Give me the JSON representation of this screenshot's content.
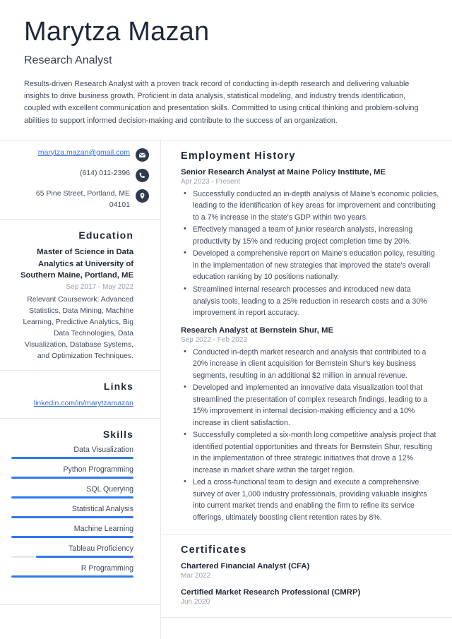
{
  "header": {
    "name": "Marytza Mazan",
    "job_title": "Research Analyst",
    "summary": "Results-driven Research Analyst with a proven track record of conducting in-depth research and delivering valuable insights to drive business growth. Proficient in data analysis, statistical modeling, and industry trends identification, coupled with excellent communication and presentation skills. Committed to using critical thinking and problem-solving abilities to support informed decision-making and contribute to the success of an organization."
  },
  "sidebar": {
    "contact": [
      {
        "icon": "envelope-icon",
        "text": "marytza.mazan@gmail.com",
        "is_link": true
      },
      {
        "icon": "phone-icon",
        "text": "(614) 011-2396",
        "is_link": false
      },
      {
        "icon": "location-pin-icon",
        "text": "65 Pine Street, Portland, ME 04101",
        "is_link": false
      }
    ],
    "education": {
      "title": "Education",
      "degree": "Master of Science in Data Analytics at University of Southern Maine, Portland, ME",
      "date": "Sep 2017 - May 2022",
      "description": "Relevant Coursework: Advanced Statistics, Data Mining, Machine Learning, Predictive Analytics, Big Data Technologies, Data Visualization, Database Systems, and Optimization Techniques."
    },
    "links": {
      "title": "Links",
      "items": [
        {
          "label": "linkedin.com/in/marytzamazan"
        }
      ]
    },
    "skills": {
      "title": "Skills",
      "items": [
        {
          "label": "Data Visualization",
          "level": 100
        },
        {
          "label": "Python Programming",
          "level": 100
        },
        {
          "label": "SQL Querying",
          "level": 100
        },
        {
          "label": "Statistical Analysis",
          "level": 100
        },
        {
          "label": "Machine Learning",
          "level": 100
        },
        {
          "label": "Tableau Proficiency",
          "level": 80
        },
        {
          "label": "R Programming",
          "level": 100
        }
      ]
    }
  },
  "main": {
    "employment": {
      "title": "Employment History",
      "entries": [
        {
          "title": "Senior Research Analyst at Maine Policy Institute, ME",
          "date": "Apr 2023 - Present",
          "bullets": [
            "Successfully conducted an in-depth analysis of Maine's economic policies, leading to the identification of key areas for improvement and contributing to a 7% increase in the state's GDP within two years.",
            "Effectively managed a team of junior research analysts, increasing productivity by 15% and reducing project completion time by 20%.",
            "Developed a comprehensive report on Maine's education policy, resulting in the implementation of new strategies that improved the state's overall education ranking by 10 positions nationally.",
            "Streamlined internal research processes and introduced new data analysis tools, leading to a 25% reduction in research costs and a 30% improvement in report accuracy."
          ]
        },
        {
          "title": "Research Analyst at Bernstein Shur, ME",
          "date": "Sep 2022 - Feb 2023",
          "bullets": [
            "Conducted in-depth market research and analysis that contributed to a 20% increase in client acquisition for Bernstein Shur's key business segments, resulting in an additional $2 million in annual revenue.",
            "Developed and implemented an innovative data visualization tool that streamlined the presentation of complex research findings, leading to a 15% improvement in internal decision-making efficiency and a 10% increase in client satisfaction.",
            "Successfully completed a six-month long competitive analysis project that identified potential opportunities and threats for Bernstein Shur, resulting in the implementation of three strategic initiatives that drove a 12% increase in market share within the target region.",
            "Led a cross-functional team to design and execute a comprehensive survey of over 1,000 industry professionals, providing valuable insights into current market trends and enabling the firm to refine its service offerings, ultimately boosting client retention rates by 8%."
          ]
        }
      ]
    },
    "certificates": {
      "title": "Certificates",
      "entries": [
        {
          "name": "Chartered Financial Analyst (CFA)",
          "date": "Mar 2022"
        },
        {
          "name": "Certified Market Research Professional (CMRP)",
          "date": "Jun 2020"
        }
      ]
    }
  },
  "colors": {
    "accent": "#2f77ef",
    "link": "#3b6fd4",
    "heading": "#1f2937",
    "body": "#3f4a5a",
    "muted": "#9aa2af",
    "divider": "#e5e7eb",
    "icon_bg": "#2f3a4d"
  }
}
